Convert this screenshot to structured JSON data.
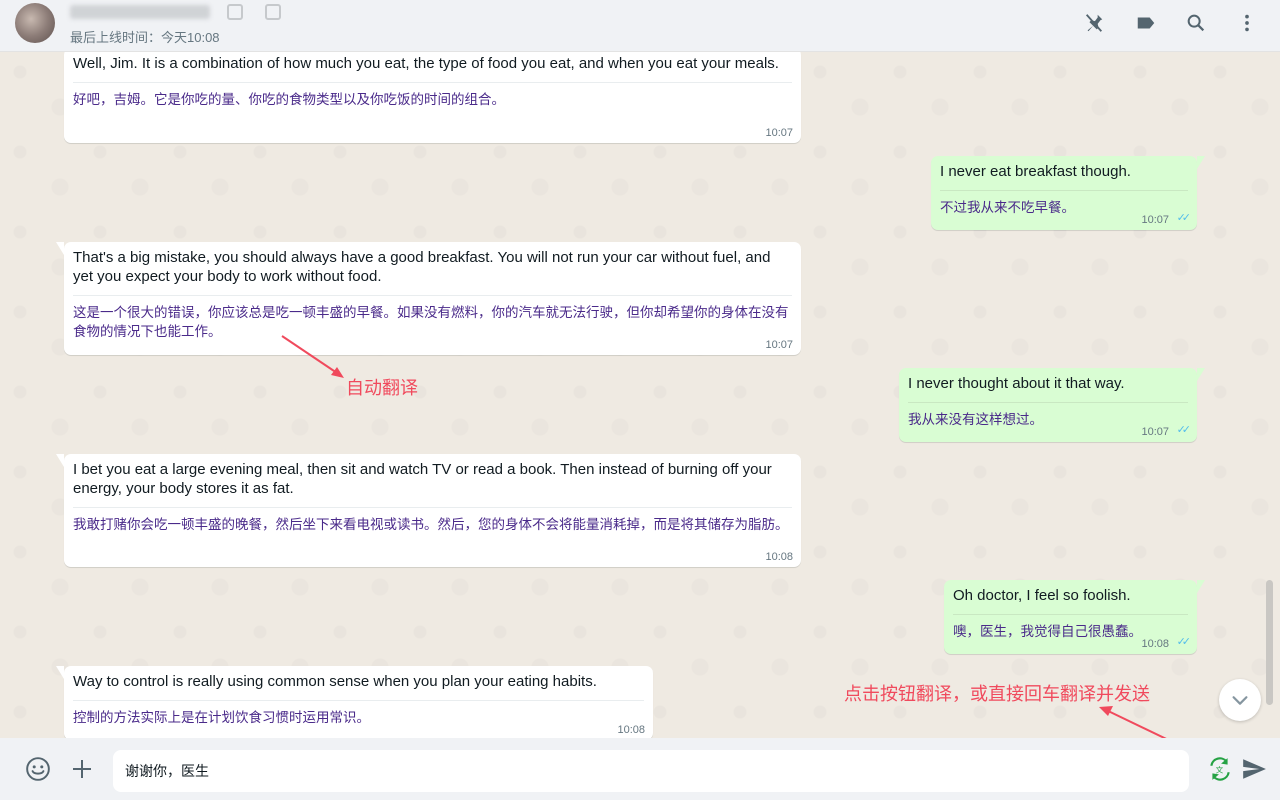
{
  "header": {
    "last_seen": "最后上线时间：今天10:08",
    "icons": [
      "pin-off-icon",
      "label-icon",
      "search-icon",
      "menu-icon"
    ]
  },
  "messages": [
    {
      "direction": "in",
      "original": "Well, Jim. It is a combination of how much you eat, the type of food you eat, and when you eat your meals.",
      "translation": "好吧，吉姆。它是你吃的量、你吃的食物类型以及你吃饭的时间的组合。",
      "time": "10:07"
    },
    {
      "direction": "out",
      "original": "I never eat breakfast though.",
      "translation": "不过我从来不吃早餐。",
      "time": "10:07"
    },
    {
      "direction": "in",
      "original": "That's a big mistake, you should always have a good breakfast. You will not run your car without fuel, and yet you expect your body to work without food.",
      "translation": "这是一个很大的错误，你应该总是吃一顿丰盛的早餐。如果没有燃料，你的汽车就无法行驶，但你却希望你的身体在没有食物的情况下也能工作。",
      "time": "10:07"
    },
    {
      "direction": "out",
      "original": "I never thought about it that way.",
      "translation": "我从来没有这样想过。",
      "time": "10:07"
    },
    {
      "direction": "in",
      "original": "I bet you eat a large evening meal, then sit and watch TV or read a book. Then instead of burning off your energy, your body stores it as fat.",
      "translation": "我敢打赌你会吃一顿丰盛的晚餐，然后坐下来看电视或读书。然后，您的身体不会将能量消耗掉，而是将其储存为脂肪。",
      "time": "10:08"
    },
    {
      "direction": "out",
      "original": "Oh doctor, I feel so foolish.",
      "translation": "噢，医生，我觉得自己很愚蠢。",
      "time": "10:08"
    },
    {
      "direction": "in",
      "original": "Way to control is really using common sense when you plan your eating habits.",
      "translation": "控制的方法实际上是在计划饮食习惯时运用常识。",
      "time": "10:08"
    }
  ],
  "annotations": {
    "auto_translate": "自动翻译",
    "send_hint": "点击按钮翻译，或直接回车翻译并发送"
  },
  "composer": {
    "value": "谢谢你，医生",
    "icons": [
      "emoji-icon",
      "attach-plus-icon",
      "translate-icon",
      "send-icon"
    ]
  },
  "colors": {
    "incoming_bubble": "#ffffff",
    "outgoing_bubble": "#d9fdd3",
    "translation_text": "#4a2a8a",
    "annotation": "#f04a5d",
    "read_ticks": "#53bdeb",
    "translate_button": "#25a244"
  }
}
